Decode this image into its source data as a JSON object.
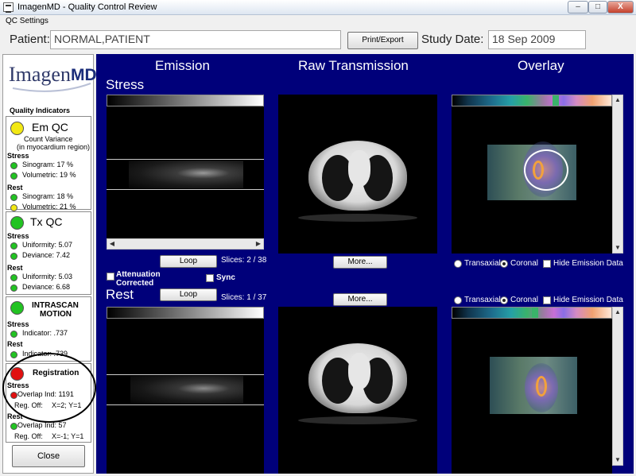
{
  "window": {
    "title": "ImagenMD - Quality Control Review",
    "minimize": "–",
    "maximize": "□",
    "close": "X"
  },
  "menu": {
    "qc_settings": "QC Settings"
  },
  "header": {
    "patient_label": "Patient:",
    "patient_value": "NORMAL,PATIENT",
    "print_button": "Print/Export",
    "study_date_label": "Study Date:",
    "study_date_value": "18 Sep 2009"
  },
  "logo": {
    "imagen": "Imagen",
    "md": "MD"
  },
  "quality": {
    "heading": "Quality Indicators",
    "em_qc": {
      "title": "Em QC",
      "status_color": "#f2e814",
      "subtitle1": "Count Variance",
      "subtitle2": "(in myocardium region)",
      "stress_label": "Stress",
      "stress_sinogram": "Sinogram:  17 %",
      "stress_volumetric": "Volumetric: 19 %",
      "rest_label": "Rest",
      "rest_sinogram": "Sinogram:  18 %",
      "rest_volumetric": "Volumetric:  21 %"
    },
    "tx_qc": {
      "title": "Tx QC",
      "status_color": "#22c322",
      "stress_label": "Stress",
      "stress_uniformity": "Uniformity:  5.07",
      "stress_deviance": "Deviance:  7.42",
      "rest_label": "Rest",
      "rest_uniformity": "Uniformity:  5.03",
      "rest_deviance": "Deviance:  6.68"
    },
    "motion": {
      "title1": "INTRASCAN",
      "title2": "MOTION",
      "status_color": "#22c322",
      "stress_label": "Stress",
      "stress_indicator": "Indicator:  .737",
      "rest_label": "Rest",
      "rest_indicator": "Indicator:  .739"
    },
    "registration": {
      "title": "Registration",
      "status_color": "#e01010",
      "stress_label": "Stress",
      "stress_overlap": "Overlap Ind:  1191",
      "stress_regoff_label": "Reg. Off:",
      "stress_regoff_value": "X=2; Y=1",
      "rest_label": "Rest",
      "rest_overlap": "Overlap Ind:  57",
      "rest_regoff_label": "Reg. Off:",
      "rest_regoff_value": "X=-1; Y=1"
    },
    "close_button": "Close"
  },
  "main": {
    "columns": {
      "emission": "Emission",
      "transmission": "Raw Transmission",
      "overlay": "Overlay"
    },
    "stress": {
      "label": "Stress",
      "loop_button": "Loop",
      "slices": "Slices:  2 /  38",
      "more_button": "More...",
      "attenuation_label": "Attenuation Corrected",
      "sync_label": "Sync"
    },
    "rest": {
      "label": "Rest",
      "loop_button": "Loop",
      "slices": "Slices:  1 /  37",
      "more_button": "More..."
    },
    "overlay_options": {
      "transaxial": "Transaxial",
      "coronal": "Coronal",
      "hide_emission": "Hide Emission Data",
      "selected": "Coronal"
    },
    "colors": {
      "panel_bg": "#00007a",
      "accent_green": "#3ab36a",
      "registration_alert": "#e01010"
    }
  }
}
